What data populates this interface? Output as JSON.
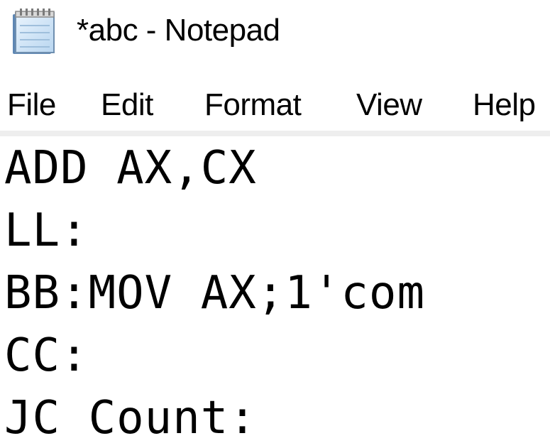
{
  "window": {
    "title": "*abc - Notepad",
    "icon": "notepad-icon"
  },
  "menu": {
    "file": "File",
    "edit": "Edit",
    "format": "Format",
    "view": "View",
    "help": "Help"
  },
  "editor": {
    "lines": [
      "ADD AX,CX",
      "LL:",
      "BB:MOV AX;1'com",
      "CC:",
      "JC Count:"
    ]
  }
}
